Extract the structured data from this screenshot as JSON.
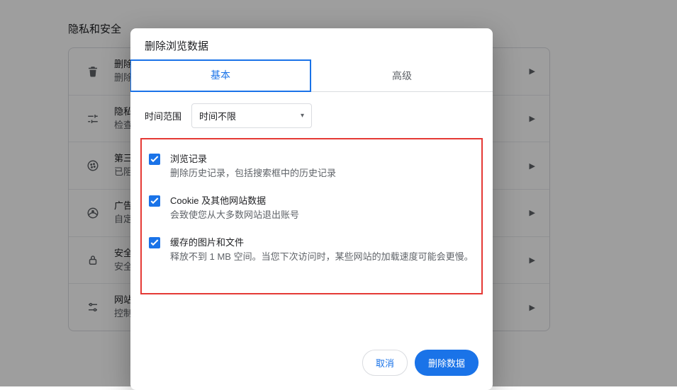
{
  "section_title": "隐私和安全",
  "rows": [
    {
      "title": "删除",
      "subtitle": "删除"
    },
    {
      "title": "隐私",
      "subtitle": "检查"
    },
    {
      "title": "第三",
      "subtitle": "已阻"
    },
    {
      "title": "广告",
      "subtitle": "自定"
    },
    {
      "title": "安全",
      "subtitle": "安全"
    },
    {
      "title": "网站",
      "subtitle": "控制"
    }
  ],
  "dialog": {
    "title": "删除浏览数据",
    "tabs": {
      "basic": "基本",
      "advanced": "高级"
    },
    "time_label": "时间范围",
    "time_value": "时间不限",
    "options": [
      {
        "title": "浏览记录",
        "desc": "删除历史记录，包括搜索框中的历史记录"
      },
      {
        "title": "Cookie 及其他网站数据",
        "desc": "会致使您从大多数网站退出账号"
      },
      {
        "title": "缓存的图片和文件",
        "desc": "释放不到 1 MB 空间。当您下次访问时，某些网站的加载速度可能会更慢。"
      }
    ],
    "cancel": "取消",
    "confirm": "删除数据"
  }
}
